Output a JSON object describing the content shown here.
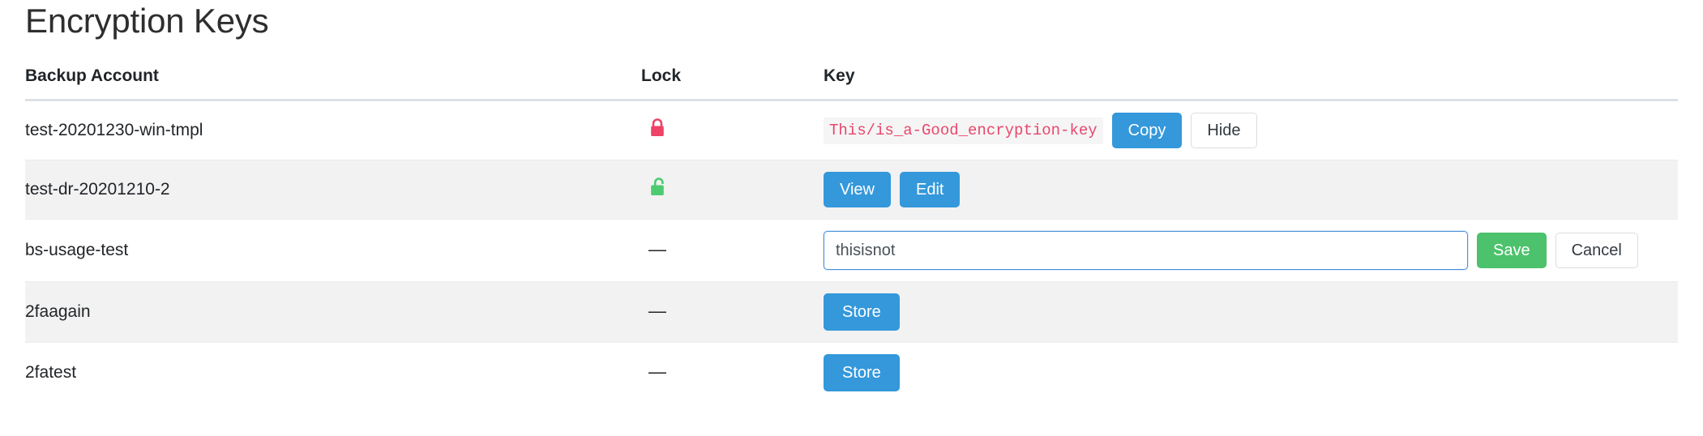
{
  "page": {
    "title": "Encryption Keys"
  },
  "table": {
    "columns": {
      "account": "Backup Account",
      "lock": "Lock",
      "key": "Key"
    },
    "rows": [
      {
        "account": "test-20201230-win-tmpl",
        "lock": {
          "state": "locked",
          "icon": "lock-closed-icon",
          "color": "#ee4266"
        },
        "key": {
          "mode": "revealed",
          "value": "This/is_a-Good_encryption-key",
          "copy_label": "Copy",
          "hide_label": "Hide"
        }
      },
      {
        "account": "test-dr-20201210-2",
        "lock": {
          "state": "unlocked",
          "icon": "lock-open-icon",
          "color": "#4ecb71"
        },
        "key": {
          "mode": "stored",
          "view_label": "View",
          "edit_label": "Edit"
        }
      },
      {
        "account": "bs-usage-test",
        "lock": {
          "state": "none",
          "icon": "em-dash",
          "color": "#212529",
          "dash": "—"
        },
        "key": {
          "mode": "editing",
          "input_value": "thisisnot",
          "input_placeholder": "",
          "save_label": "Save",
          "cancel_label": "Cancel"
        }
      },
      {
        "account": "2faagain",
        "lock": {
          "state": "none",
          "icon": "em-dash",
          "color": "#212529",
          "dash": "—"
        },
        "key": {
          "mode": "empty",
          "store_label": "Store"
        }
      },
      {
        "account": "2fatest",
        "lock": {
          "state": "none",
          "icon": "em-dash",
          "color": "#212529",
          "dash": "—"
        },
        "key": {
          "mode": "empty",
          "store_label": "Store"
        }
      }
    ]
  },
  "colors": {
    "primary": "#3498db",
    "success": "#4cc26c",
    "code_text": "#e8476b",
    "code_bg": "#f5f5f5",
    "lock_closed": "#ee4266",
    "lock_open": "#4ecb71",
    "stripe": "#f2f2f2",
    "header_border": "#dee2e6"
  }
}
